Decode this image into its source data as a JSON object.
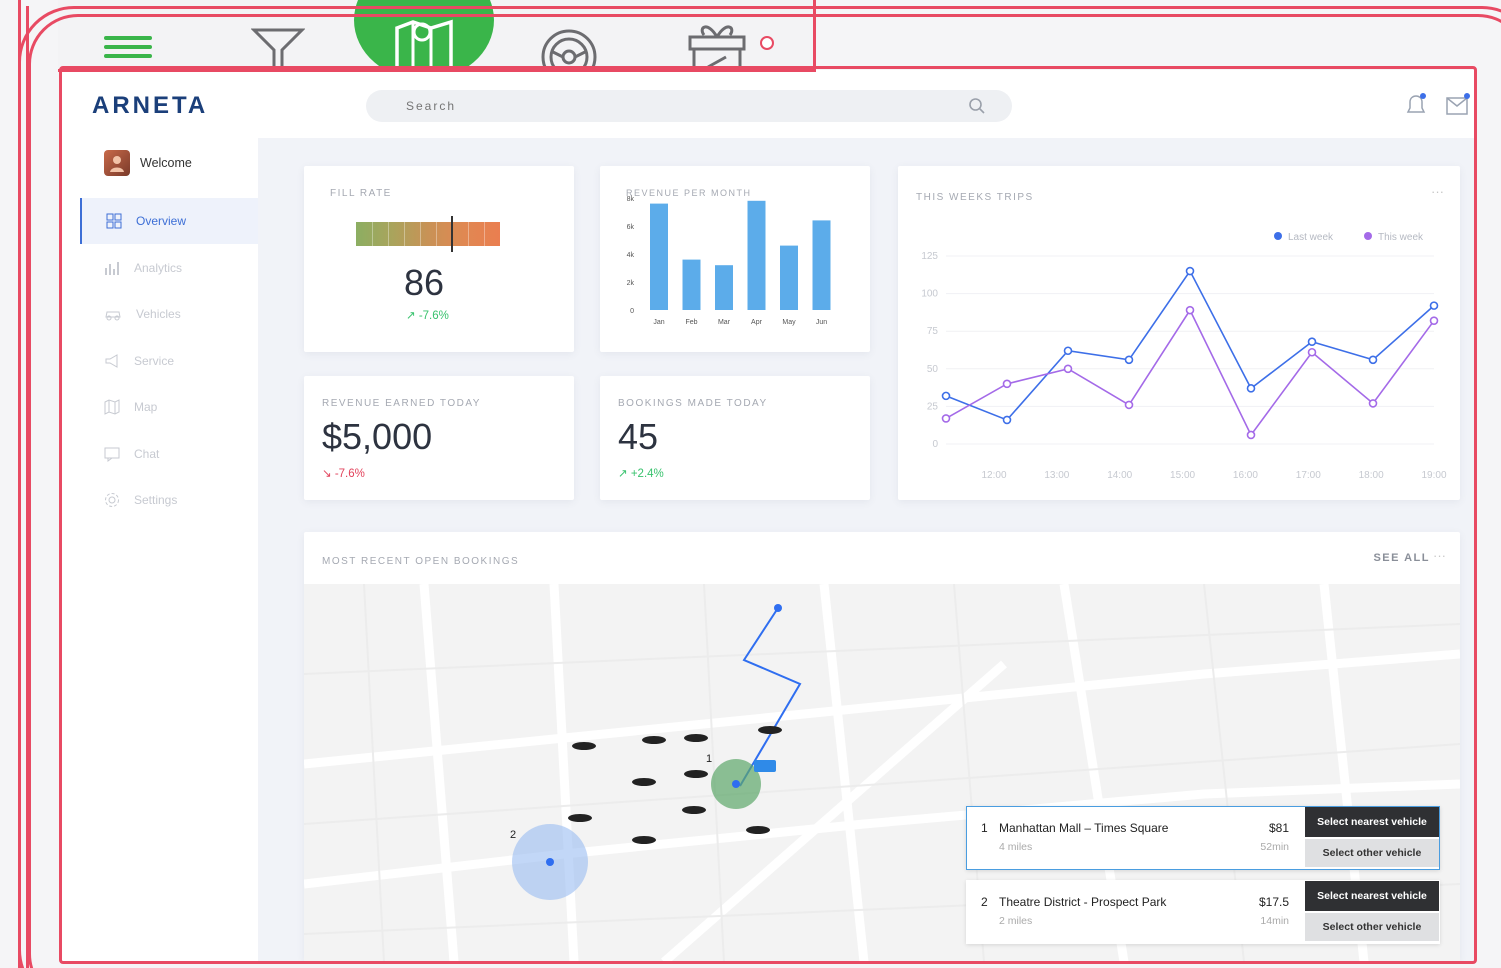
{
  "brand": {
    "logo_text": "ARNETA"
  },
  "top_icons": [
    "menu-icon",
    "filter-icon",
    "map-icon",
    "steering-wheel-icon",
    "gift-icon"
  ],
  "search": {
    "placeholder": "Search"
  },
  "user": {
    "welcome": "Welcome"
  },
  "sidebar": {
    "items": [
      {
        "label": "Overview",
        "icon": "grid-icon",
        "active": true
      },
      {
        "label": "Analytics",
        "icon": "bar-chart-icon",
        "active": false
      },
      {
        "label": "Vehicles",
        "icon": "car-icon",
        "active": false
      },
      {
        "label": "Service",
        "icon": "megaphone-icon",
        "active": false
      },
      {
        "label": "Map",
        "icon": "map-icon",
        "active": false
      },
      {
        "label": "Chat",
        "icon": "chat-icon",
        "active": false
      },
      {
        "label": "Settings",
        "icon": "gear-icon",
        "active": false
      }
    ]
  },
  "cards": {
    "fill_rate": {
      "title": "FILL RATE",
      "value": "86",
      "delta": "↗ -7.6%"
    },
    "revenue_month": {
      "title": "REVENUE PER MONTH"
    },
    "trips": {
      "title": "THIS WEEKS TRIPS",
      "more": "···"
    },
    "revenue_today": {
      "title": "REVENUE EARNED TODAY",
      "value": "$5,000",
      "delta": "↘ -7.6%"
    },
    "bookings_today": {
      "title": "BOOKINGS MADE TODAY",
      "value": "45",
      "delta": "↗ +2.4%"
    },
    "recent": {
      "title": "MOST RECENT OPEN BOOKINGS",
      "see_all": "SEE ALL",
      "more": "···"
    }
  },
  "gauge": {
    "level": 0.66
  },
  "chart_data": [
    {
      "type": "bar",
      "title": "REVENUE PER MONTH",
      "categories": [
        "Jan",
        "Feb",
        "Mar",
        "Apr",
        "May",
        "Jun"
      ],
      "values": [
        7.6,
        3.6,
        3.2,
        7.8,
        4.6,
        6.4
      ],
      "yticks": [
        "0",
        "2k",
        "4k",
        "6k",
        "8k"
      ],
      "ylim": [
        0,
        8
      ],
      "color": "#4aa3e8"
    },
    {
      "type": "line",
      "title": "THIS WEEKS TRIPS",
      "x": [
        "12:00",
        "13:00",
        "14:00",
        "15:00",
        "16:00",
        "17:00",
        "18:00",
        "19:00"
      ],
      "yticks": [
        "0",
        "25",
        "50",
        "75",
        "100",
        "125"
      ],
      "ylim": [
        0,
        125
      ],
      "legend_position": "top-right",
      "series": [
        {
          "name": "Last week",
          "color": "#3d6fe8",
          "values": [
            32,
            16,
            62,
            56,
            115,
            37,
            68,
            56,
            92
          ]
        },
        {
          "name": "This week",
          "color": "#a46ae8",
          "values": [
            17,
            40,
            50,
            26,
            89,
            6,
            61,
            27,
            82
          ]
        }
      ]
    }
  ],
  "map": {
    "marker_1_label": "1",
    "marker_2_label": "2"
  },
  "bookings": [
    {
      "num": "1",
      "name": "Manhattan Mall – Times Square",
      "distance": "4 miles",
      "price": "$81",
      "time": "52min",
      "primary": "Select nearest vehicle",
      "secondary": "Select other vehicle"
    },
    {
      "num": "2",
      "name": "Theatre District - Prospect Park",
      "distance": "2 miles",
      "price": "$17.5",
      "time": "14min",
      "primary": "Select nearest vehicle",
      "secondary": "Select other vehicle"
    }
  ]
}
